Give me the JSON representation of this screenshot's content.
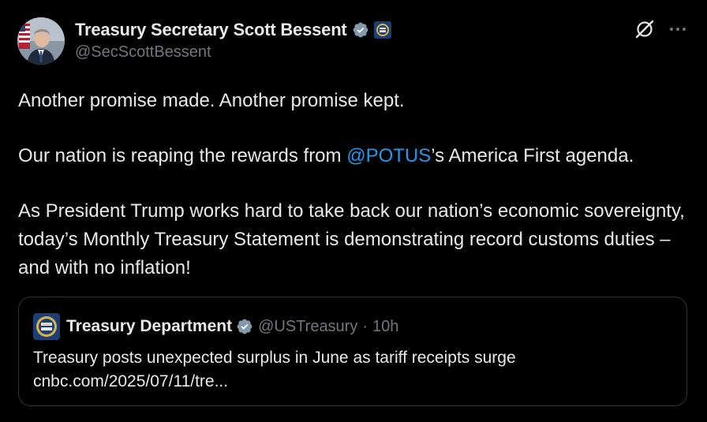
{
  "author": {
    "display_name": "Treasury Secretary Scott Bessent",
    "handle": "@SecScottBessent",
    "verified_icon": "verified-badge-icon",
    "affiliation_icon": "treasury-seal-icon"
  },
  "actions": {
    "grok_icon": "grok-icon",
    "more_label": "···"
  },
  "tweet": {
    "line1": "Another promise made. Another promise kept.",
    "line2_before": "Our nation is reaping the rewards from ",
    "line2_mention": "@POTUS",
    "line2_after": "’s America First agenda.",
    "line3": "As President Trump works hard to take back our nation’s economic sovereignty, today’s Monthly Treasury Statement is demonstrating record customs duties – and with no inflation!"
  },
  "quote": {
    "display_name": "Treasury Department",
    "handle": "@USTreasury",
    "separator": "·",
    "time": "10h",
    "headline": "Treasury posts unexpected surplus in June as tariff receipts surge",
    "link": "cnbc.com/2025/07/11/tre..."
  },
  "colors": {
    "background": "#000000",
    "text": "#e7e9ea",
    "secondary": "#71767b",
    "accent": "#1d9bf0",
    "border": "#2f3336"
  }
}
